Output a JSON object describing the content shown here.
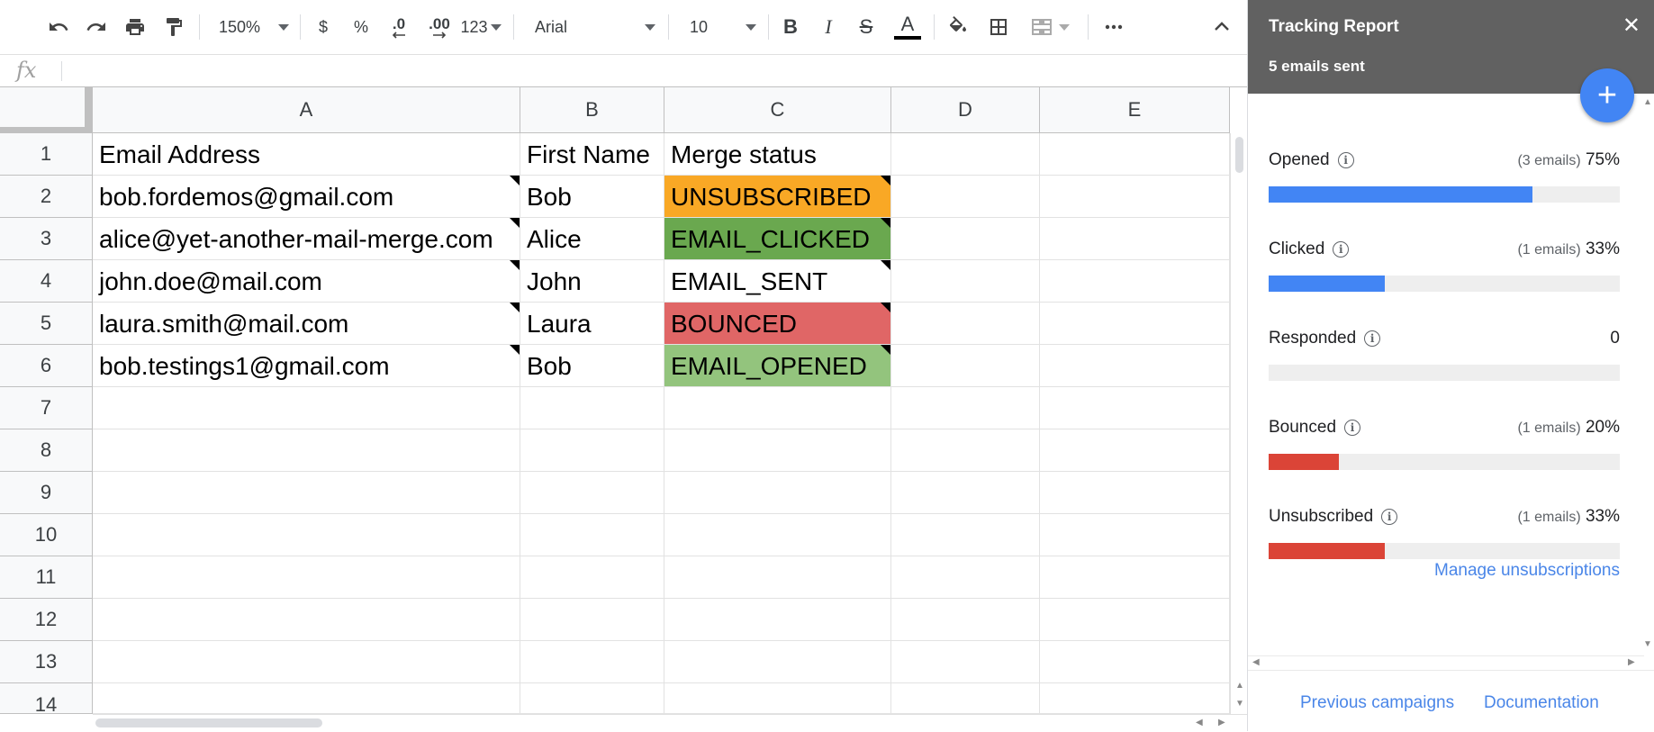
{
  "toolbar": {
    "zoom": "150%",
    "currency": "$",
    "percent": "%",
    "decrease_decimal": ".0",
    "increase_decimal": ".00",
    "more_formats": "123",
    "font": "Arial",
    "font_size": "10",
    "bold": "B",
    "italic": "I",
    "strikethrough": "S",
    "text_color_glyph": "A",
    "text_color": "#000000"
  },
  "formula_bar": {
    "fx": "fx",
    "value": ""
  },
  "grid": {
    "columns": [
      "A",
      "B",
      "C",
      "D",
      "E"
    ],
    "rows": [
      "1",
      "2",
      "3",
      "4",
      "5",
      "6",
      "7",
      "8",
      "9",
      "10",
      "11",
      "12",
      "13",
      "14"
    ],
    "header_row": {
      "a": "Email Address",
      "b": "First Name",
      "c": "Merge status"
    },
    "data": [
      {
        "email": "bob.fordemos@gmail.com",
        "name": "Bob",
        "status": "UNSUBSCRIBED",
        "color": "#f9a825"
      },
      {
        "email": "alice@yet-another-mail-merge.com",
        "name": "Alice",
        "status": "EMAIL_CLICKED",
        "color": "#6aa84f"
      },
      {
        "email": "john.doe@mail.com",
        "name": "John",
        "status": "EMAIL_SENT",
        "color": "#ffffff"
      },
      {
        "email": "laura.smith@mail.com",
        "name": "Laura",
        "status": "BOUNCED",
        "color": "#e06666"
      },
      {
        "email": "bob.testings1@gmail.com",
        "name": "Bob",
        "status": "EMAIL_OPENED",
        "color": "#93c47d"
      }
    ]
  },
  "sidebar": {
    "title": "Tracking Report",
    "subtitle": "5 emails sent",
    "close_glyph": "✕",
    "add_glyph": "+",
    "metrics": [
      {
        "label": "Opened",
        "count": "(3 emails)",
        "value": "75%",
        "fraction": 0.75,
        "color": "#4285f4"
      },
      {
        "label": "Clicked",
        "count": "(1 emails)",
        "value": "33%",
        "fraction": 0.33,
        "color": "#4285f4"
      },
      {
        "label": "Responded",
        "count": "",
        "value": "0",
        "fraction": 0,
        "color": "#4285f4"
      },
      {
        "label": "Bounced",
        "count": "(1 emails)",
        "value": "20%",
        "fraction": 0.2,
        "color": "#db4437"
      },
      {
        "label": "Unsubscribed",
        "count": "(1 emails)",
        "value": "33%",
        "fraction": 0.33,
        "color": "#db4437"
      }
    ],
    "manage_link": "Manage unsubscriptions",
    "footer": {
      "previous": "Previous campaigns",
      "docs": "Documentation"
    }
  }
}
